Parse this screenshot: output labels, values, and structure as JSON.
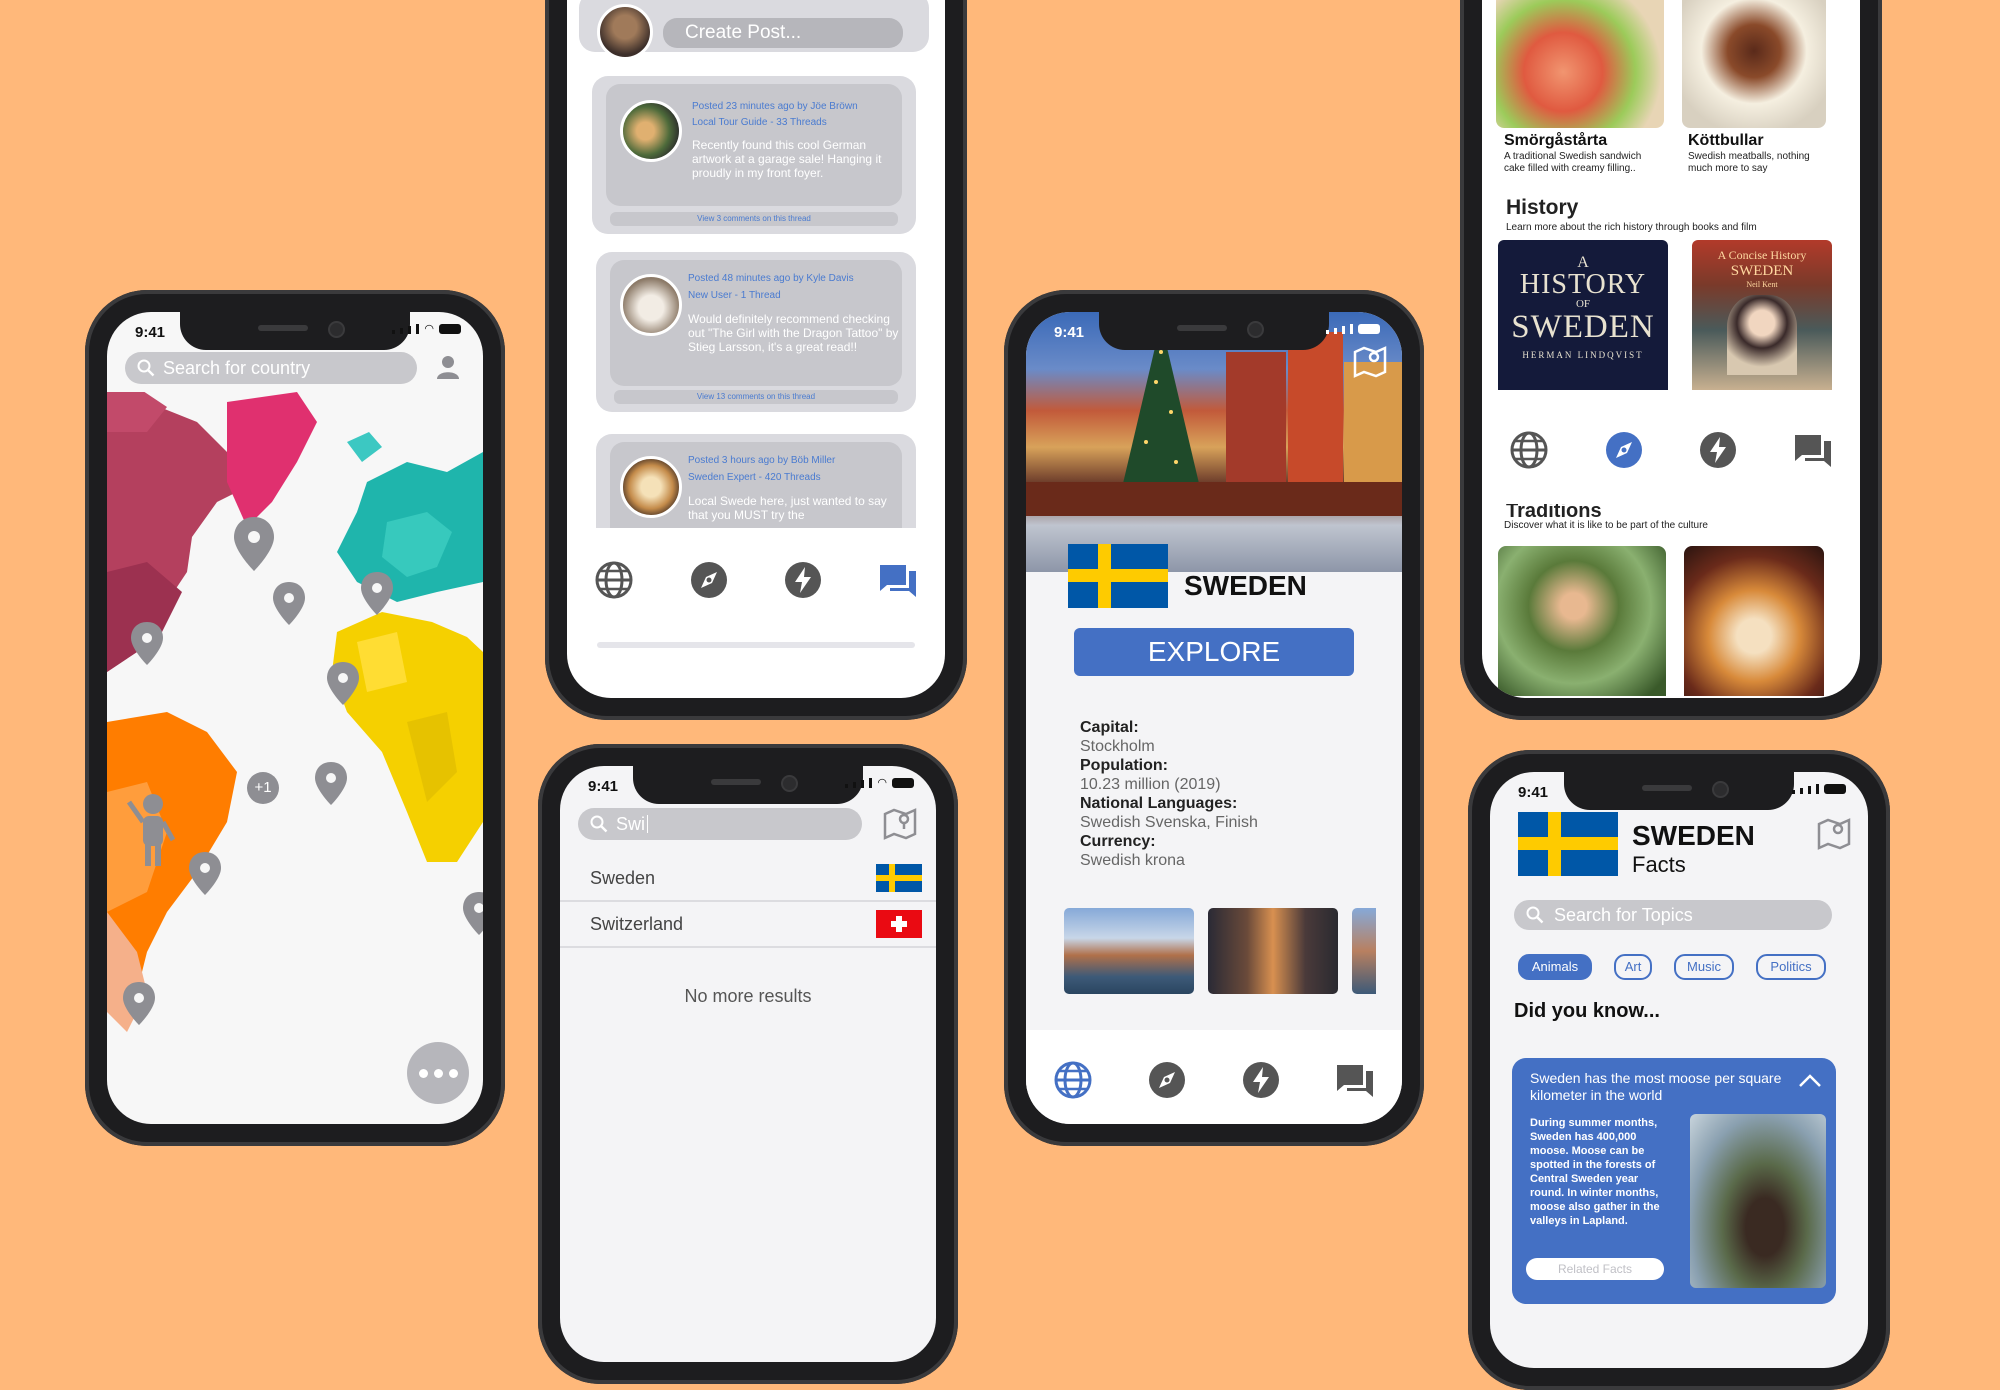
{
  "colors": {
    "background": "#ffb87a",
    "accent": "#4470c4",
    "swedenBlue": "#0057a7",
    "swedenYellow": "#fecb00"
  },
  "status": {
    "time": "9:41"
  },
  "map_screen": {
    "search_placeholder": "Search for country",
    "cluster_badge": "+1",
    "icons": {
      "search": "search-icon",
      "profile": "user-icon",
      "more": "more-icon"
    }
  },
  "forum_screen": {
    "create_post": "Create Post...",
    "posts": [
      {
        "meta": "Posted 23 minutes ago by Jöe Bröwn",
        "role": "Local Tour Guide - 33 Threads",
        "text": "Recently found this cool German artwork at a garage sale! Hanging it proudly in my front foyer.",
        "link": "View 3 comments on this thread"
      },
      {
        "meta": "Posted 48 minutes ago by Kyle Davis",
        "role": "New User - 1 Thread",
        "text": "Would definitely recommend checking out \"The Girl with the Dragon Tattoo\" by Stieg Larsson, it's a great read!!",
        "link": "View 13 comments on this thread"
      },
      {
        "meta": "Posted 3 hours ago by Böb Miller",
        "role": "Sweden Expert - 420 Threads",
        "text": "Local Swede here, just wanted to say that you MUST try the",
        "link": ""
      }
    ]
  },
  "search_screen": {
    "query": "Swi",
    "results": [
      {
        "name": "Sweden",
        "flag": "sweden-flag-icon"
      },
      {
        "name": "Switzerland",
        "flag": "switzerland-flag-icon"
      }
    ],
    "no_more": "No more results"
  },
  "country_screen": {
    "country": "SWEDEN",
    "explore": "EXPLORE",
    "facts": [
      {
        "label": "Capital:",
        "value": "Stockholm"
      },
      {
        "label": "Population:",
        "value": "10.23 million (2019)"
      },
      {
        "label": "National Languages:",
        "value": "Swedish Svenska,  Finish"
      },
      {
        "label": "Currency:",
        "value": "Swedish krona"
      }
    ]
  },
  "culture_screen": {
    "foods": [
      {
        "name": "Smörgåstårta",
        "desc": "A traditional Swedish sandwich cake filled with creamy filling.."
      },
      {
        "name": "Köttbullar",
        "desc": "Swedish meatballs, nothing much more to say"
      }
    ],
    "history_title": "History",
    "history_desc": "Learn more about the rich history through books and film",
    "book1": {
      "line1": "A",
      "line2": "HISTORY",
      "line3": "OF",
      "line4": "SWEDEN",
      "author": "HERMAN LINDQVIST"
    },
    "book2": {
      "line1": "A Concise History",
      "line2": "SWEDEN",
      "author": "Neil Kent"
    },
    "traditions_title": "Traditions",
    "traditions_desc": "Discover what it is like to be part of the culture"
  },
  "facts_screen": {
    "country": "SWEDEN",
    "subtitle": "Facts",
    "search_placeholder": "Search for Topics",
    "topics": [
      "Animals",
      "Art",
      "Music",
      "Politics"
    ],
    "did_you_know": "Did you know...",
    "fact_title": "Sweden has the most moose per square kilometer in the world",
    "fact_body": "During summer months, Sweden has 400,000 moose. Moose can be spotted in the forests of Central Sweden year round. In winter months, moose also gather in the valleys in Lapland.",
    "related": "Related Facts"
  }
}
